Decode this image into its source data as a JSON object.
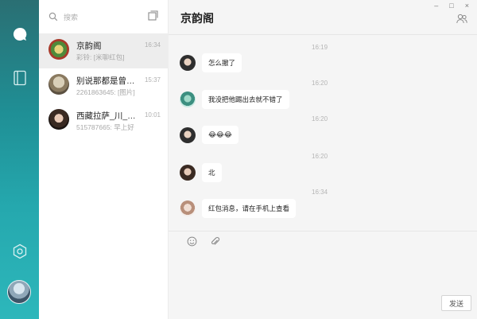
{
  "window": {
    "minimize": "–",
    "maximize": "□",
    "close": "×"
  },
  "search": {
    "placeholder": "搜索"
  },
  "conversations": [
    {
      "name": "京韵阁",
      "time": "16:34",
      "snippet": "彩铃: [米聊红包]",
      "selected": true
    },
    {
      "name": "别说那都是曾…",
      "time": "15:37",
      "snippet": "2261863645: [图片]",
      "selected": false
    },
    {
      "name": "西藏拉萨_川_…",
      "time": "10:01",
      "snippet": "515787665: 早上好",
      "selected": false
    }
  ],
  "chat": {
    "title": "京韵阁",
    "messages": [
      {
        "time": "16:19",
        "text": "怎么撤了"
      },
      {
        "time": "16:20",
        "text": "我没把他踢出去就不错了"
      },
      {
        "time": "16:20",
        "text": "😂😂😂"
      },
      {
        "time": "16:20",
        "text": "北"
      },
      {
        "time": "16:34",
        "text": "红包消息，请在手机上查看"
      }
    ],
    "send_label": "发送"
  },
  "colors": {
    "rail_top": "#2a6f73",
    "rail_bottom": "#2db7bb",
    "selected_row": "#ededed"
  },
  "icons": [
    "chat-icon",
    "contacts-book-icon",
    "settings-hex-icon",
    "search-icon",
    "new-chat-icon",
    "group-members-icon",
    "emoji-icon",
    "attachment-icon"
  ]
}
